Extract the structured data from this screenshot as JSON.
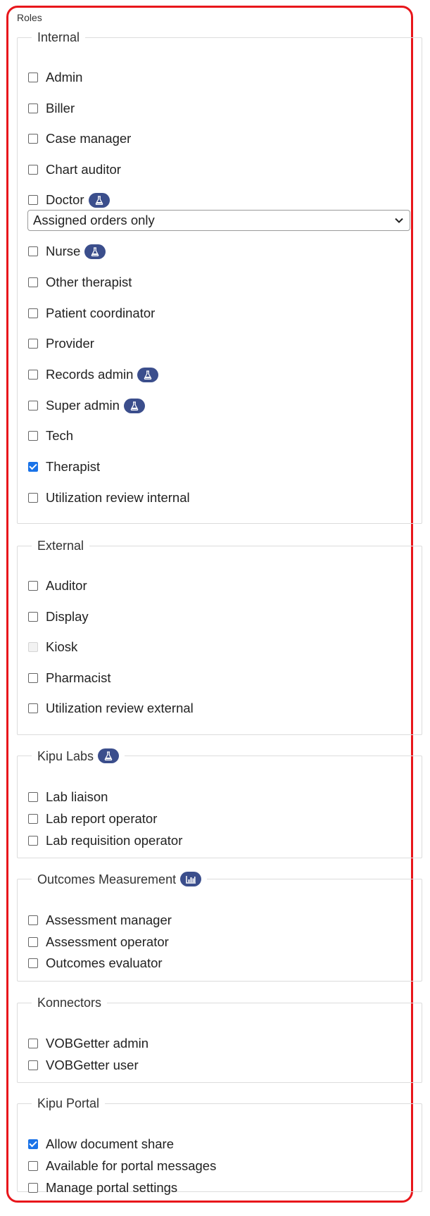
{
  "title": "Roles",
  "groups": {
    "internal": {
      "legend": "Internal",
      "items": [
        {
          "label": "Admin",
          "checked": false
        },
        {
          "label": "Biller",
          "checked": false
        },
        {
          "label": "Case manager",
          "checked": false
        },
        {
          "label": "Chart auditor",
          "checked": false
        },
        {
          "label": "Doctor",
          "checked": false,
          "badge": "flask-icon"
        },
        {
          "label": "Nurse",
          "checked": false,
          "badge": "flask-icon"
        },
        {
          "label": "Other therapist",
          "checked": false
        },
        {
          "label": "Patient coordinator",
          "checked": false
        },
        {
          "label": "Provider",
          "checked": false
        },
        {
          "label": "Records admin",
          "checked": false,
          "badge": "flask-icon"
        },
        {
          "label": "Super admin",
          "checked": false,
          "badge": "flask-icon"
        },
        {
          "label": "Tech",
          "checked": false
        },
        {
          "label": "Therapist",
          "checked": true
        },
        {
          "label": "Utilization review internal",
          "checked": false
        }
      ],
      "doctor_select": {
        "value": "Assigned orders only"
      }
    },
    "external": {
      "legend": "External",
      "items": [
        {
          "label": "Auditor",
          "checked": false
        },
        {
          "label": "Display",
          "checked": false
        },
        {
          "label": "Kiosk",
          "checked": false,
          "disabled": true
        },
        {
          "label": "Pharmacist",
          "checked": false
        },
        {
          "label": "Utilization review external",
          "checked": false
        }
      ]
    },
    "kipu_labs": {
      "legend": "Kipu Labs",
      "legend_badge": "flask-icon",
      "items": [
        {
          "label": "Lab liaison",
          "checked": false
        },
        {
          "label": "Lab report operator",
          "checked": false
        },
        {
          "label": "Lab requisition operator",
          "checked": false
        }
      ]
    },
    "outcomes": {
      "legend": "Outcomes Measurement",
      "legend_badge": "chart-icon",
      "items": [
        {
          "label": "Assessment manager",
          "checked": false
        },
        {
          "label": "Assessment operator",
          "checked": false
        },
        {
          "label": "Outcomes evaluator",
          "checked": false
        }
      ]
    },
    "konnectors": {
      "legend": "Konnectors",
      "items": [
        {
          "label": "VOBGetter admin",
          "checked": false
        },
        {
          "label": "VOBGetter user",
          "checked": false
        }
      ]
    },
    "kipu_portal": {
      "legend": "Kipu Portal",
      "items": [
        {
          "label": "Allow document share",
          "checked": true
        },
        {
          "label": "Available for portal messages",
          "checked": false
        },
        {
          "label": "Manage portal settings",
          "checked": false
        }
      ]
    }
  },
  "colors": {
    "frame": "#e8161b",
    "badge": "#3b4e8c",
    "checkbox_checked": "#1a73e8"
  }
}
